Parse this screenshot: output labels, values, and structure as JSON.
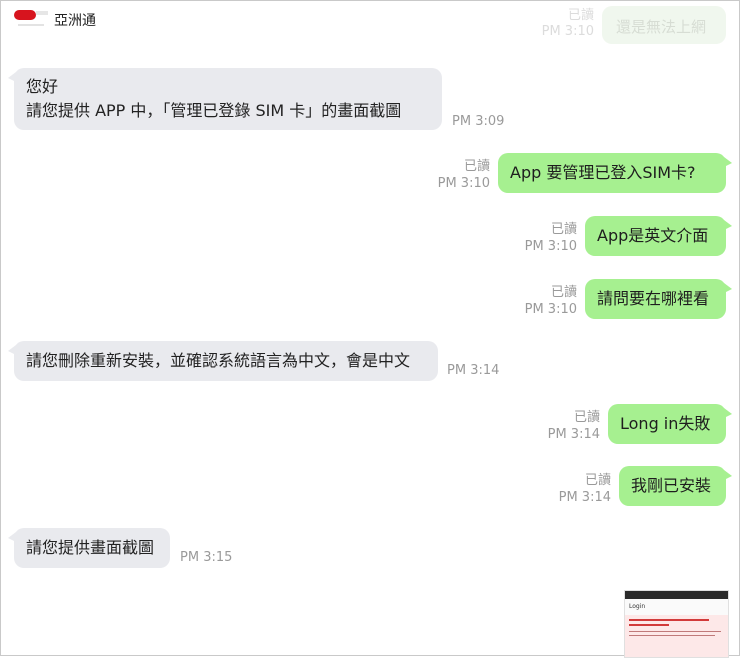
{
  "header": {
    "title": "亞洲通"
  },
  "ghost": {
    "status": "已讀",
    "time": "PM 3:10",
    "message": "還是無法上網"
  },
  "messages": [
    {
      "side": "in",
      "lines": [
        "您好",
        "請您提供 APP 中，「管理已登錄 SIM 卡」的畫面截圖"
      ],
      "time": "PM 3:09"
    },
    {
      "side": "out",
      "text": "App 要管理已登入SIM卡?",
      "status": "已讀",
      "time": "PM 3:10"
    },
    {
      "side": "out",
      "text": "App是英文介面",
      "status": "已讀",
      "time": "PM 3:10"
    },
    {
      "side": "out",
      "text": "請問要在哪裡看",
      "status": "已讀",
      "time": "PM 3:10"
    },
    {
      "side": "in",
      "text": "請您刪除重新安裝，並確認系統語言為中文，會是中文",
      "time": "PM 3:14"
    },
    {
      "side": "out",
      "text": "Long in失敗",
      "status": "已讀",
      "time": "PM 3:14"
    },
    {
      "side": "out",
      "text": "我剛已安裝",
      "status": "已讀",
      "time": "PM 3:14"
    },
    {
      "side": "in",
      "text": "請您提供畫面截圖",
      "time": "PM 3:15"
    }
  ],
  "screenshot_thumb": {
    "title": "Login"
  }
}
